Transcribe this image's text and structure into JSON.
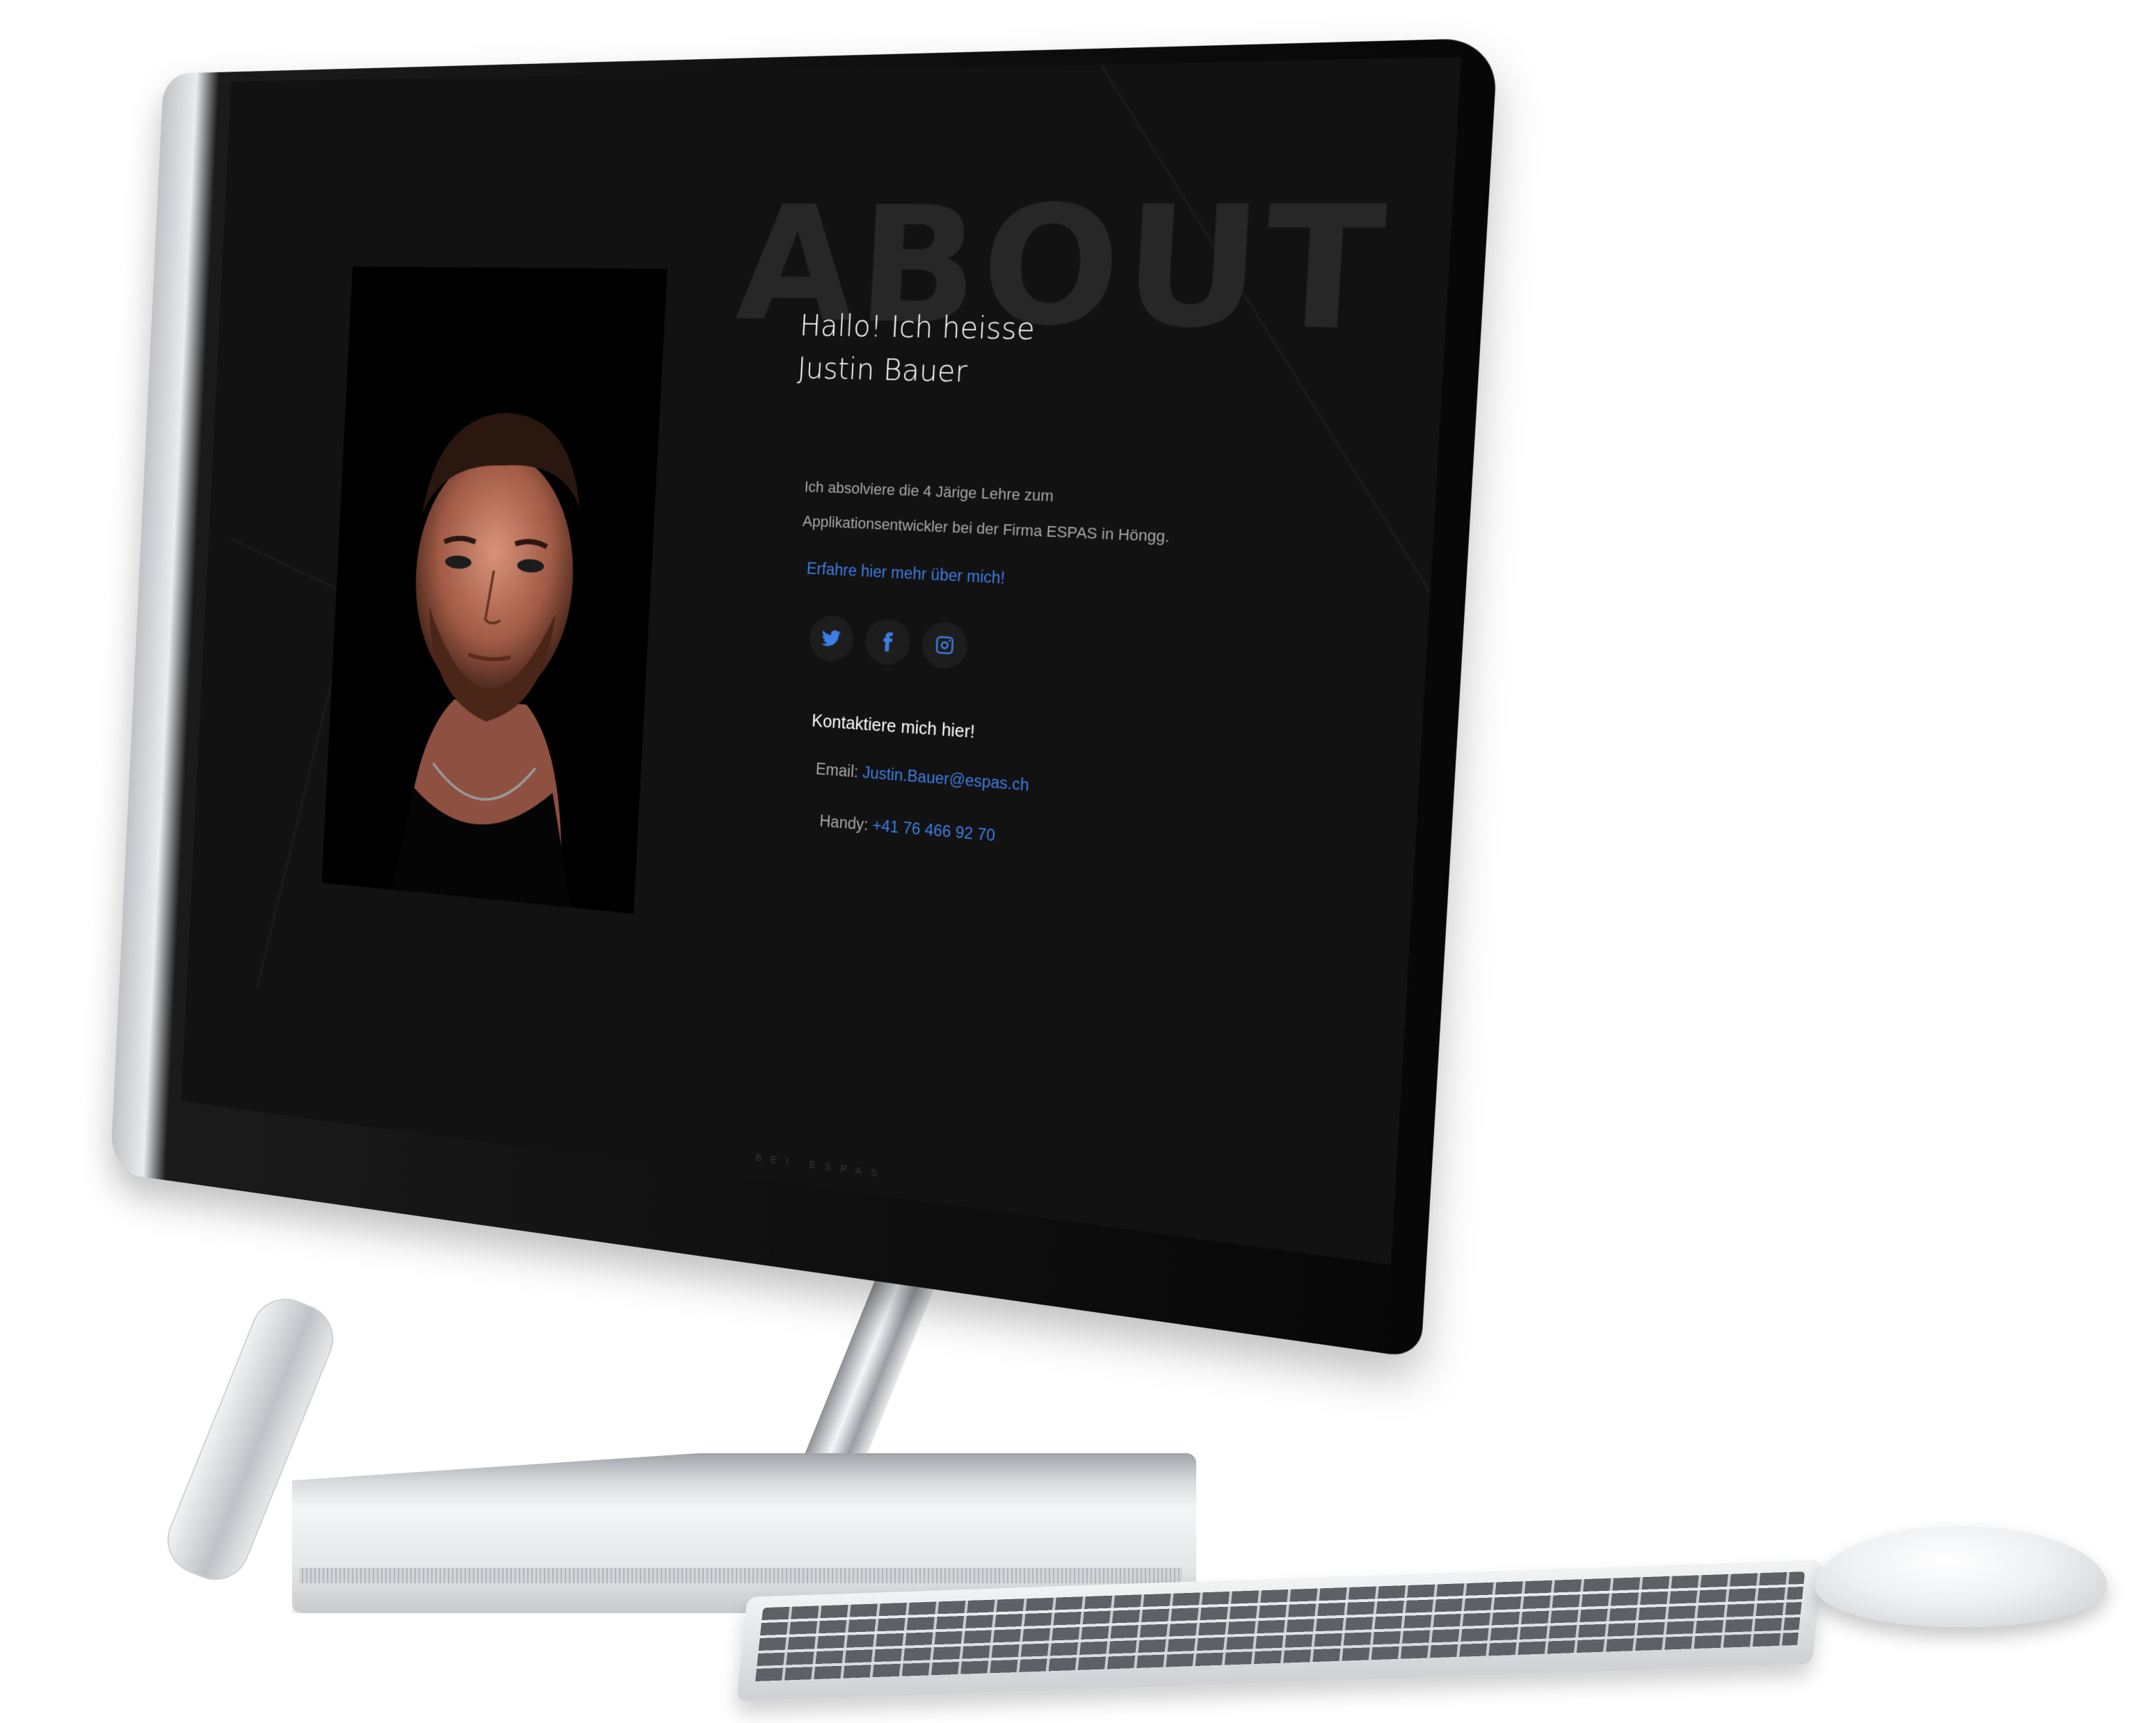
{
  "about": {
    "bg_title": "ABOUT",
    "headline": "Hallo! Ich heisse Justin Bauer",
    "bio": "Ich absolviere die 4 Järige Lehre zum Applikationsentwickler bei der Firma ESPAS in Höngg.",
    "more_link": "Erfahre hier mehr über mich!"
  },
  "socials": [
    {
      "icon": "twitter-icon"
    },
    {
      "icon": "facebook-icon"
    },
    {
      "icon": "instagram-icon"
    }
  ],
  "contact": {
    "title": "Kontaktiere mich hier!",
    "email_label": "Email:",
    "email_value": "Justin.Bauer@espas.ch",
    "phone_label": "Handy:",
    "phone_value": "+41 76 466 92 70"
  },
  "footer": {
    "text": "BEI ESPAS"
  },
  "colors": {
    "background": "#121212",
    "accent": "#3d7de6",
    "text_primary": "#ffffff",
    "text_secondary": "#a8a8a8"
  }
}
